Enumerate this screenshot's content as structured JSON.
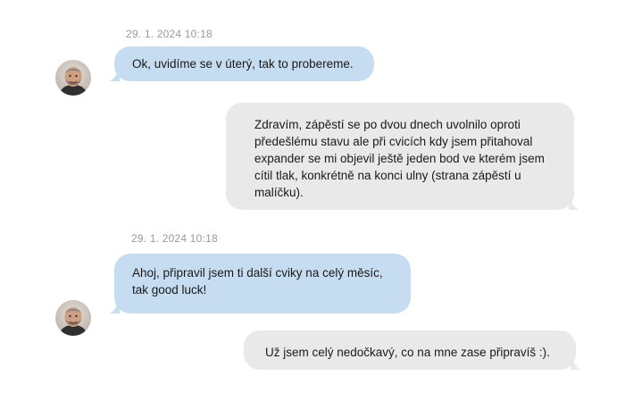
{
  "messages": [
    {
      "direction": "incoming",
      "timestamp": "29. 1. 2024 10:18",
      "text": "Ok, uvidíme se v úterý, tak to probereme."
    },
    {
      "direction": "outgoing",
      "text": "Zdravím, zápěstí se po dvou dnech uvolnilo oproti předešlému stavu ale při cvicích kdy jsem přitahoval expander se mi objevil ještě jeden bod ve kterém jsem cítil tlak, konkrétně na konci ulny (strana zápěstí u malíčku)."
    },
    {
      "direction": "incoming",
      "timestamp": "29. 1. 2024 10:18",
      "text": "Ahoj, připravil jsem ti další cviky na celý měsíc, tak good luck!"
    },
    {
      "direction": "outgoing",
      "text": "Už jsem celý nedočkavý, co na mne zase připravíš :)."
    }
  ],
  "colors": {
    "incoming_bubble": "#c5dcf1",
    "outgoing_bubble": "#e9e9e9",
    "timestamp": "#9a9a9a"
  }
}
